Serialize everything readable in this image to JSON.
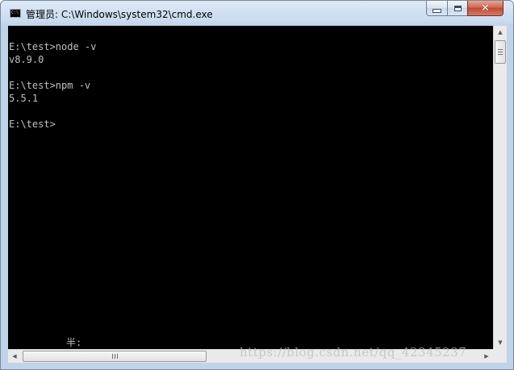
{
  "window": {
    "title": "管理员: C:\\Windows\\system32\\cmd.exe",
    "icon": "cmd-icon",
    "icon_text": "C:\\",
    "controls": {
      "minimize": "minimize-icon",
      "maximize": "maximize-icon",
      "close_glyph": "✕"
    }
  },
  "console": {
    "lines": [
      "",
      "E:\\test>node -v",
      "v8.9.0",
      "",
      "E:\\test>npm -v",
      "5.5.1",
      "",
      "E:\\test>"
    ],
    "status_text": "半:",
    "colors": {
      "background": "#000000",
      "foreground": "#c0c0c0"
    }
  },
  "scrollbars": {
    "up_arrow": "▲",
    "down_arrow": "▼",
    "left_arrow": "◀",
    "right_arrow": "▶"
  },
  "watermark": "https://blog.csdn.net/qq_42345237"
}
